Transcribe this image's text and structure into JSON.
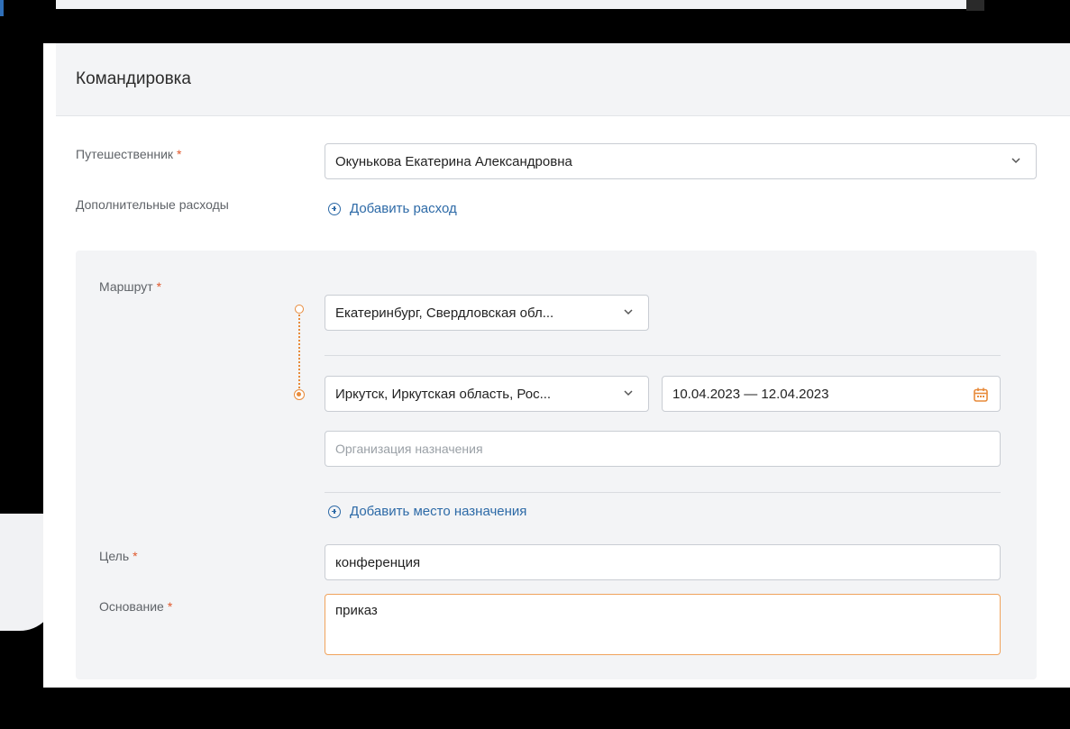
{
  "card": {
    "title": "Командировка"
  },
  "traveler": {
    "label": "Путешественник",
    "required_mark": "*",
    "value": "Окунькова Екатерина Александровна"
  },
  "extra_expenses": {
    "label": "Дополнительные расходы",
    "add_label": "Добавить расход"
  },
  "route": {
    "label": "Маршрут",
    "required_mark": "*",
    "origin": "Екатеринбург, Свердловская обл...",
    "destination": "Иркутск, Иркутская область, Рос...",
    "dates": "10.04.2023 — 12.04.2023",
    "org_placeholder": "Организация назначения",
    "add_destination_label": "Добавить место назначения"
  },
  "purpose": {
    "label": "Цель",
    "required_mark": "*",
    "value": "конференция"
  },
  "basis": {
    "label": "Основание",
    "required_mark": "*",
    "value": "приказ"
  },
  "colors": {
    "accent": "#2d6aa7",
    "required": "#e0582c",
    "route_dot": "#e88b3b",
    "focus": "#f0a35c"
  }
}
